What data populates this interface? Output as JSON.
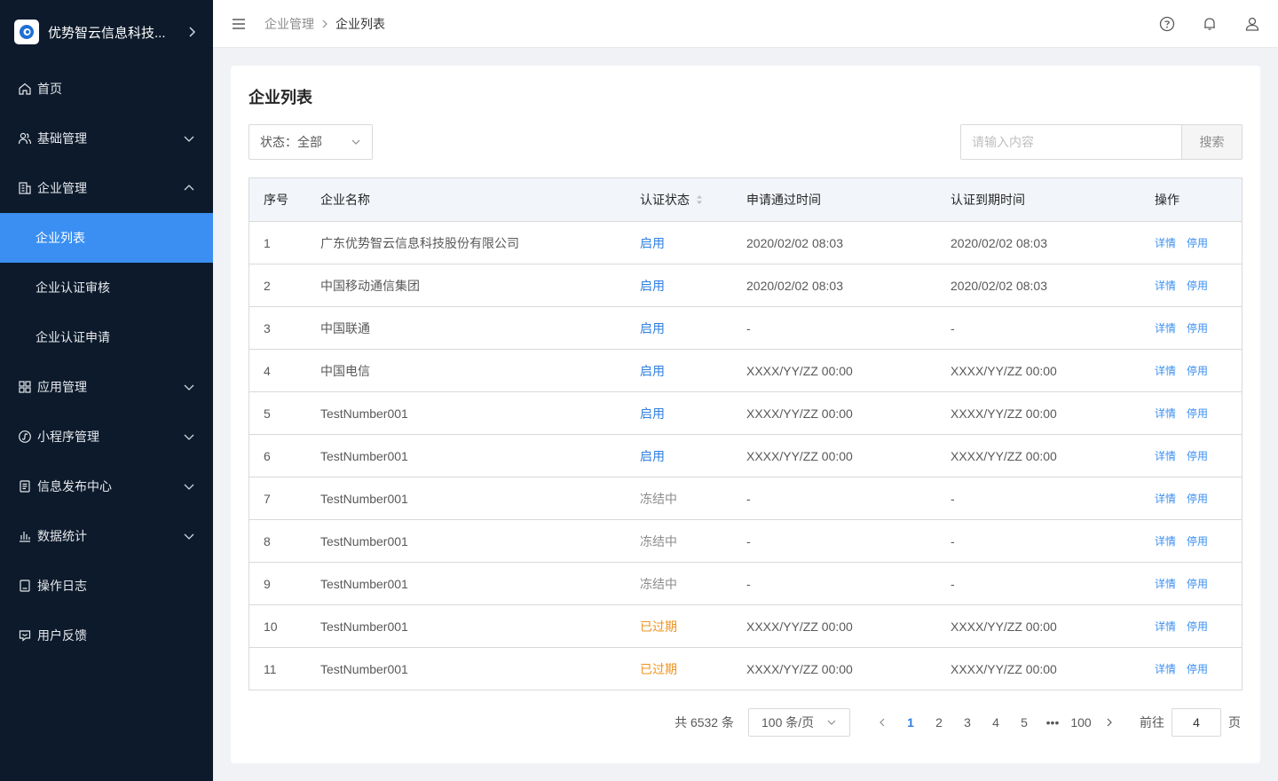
{
  "brand": {
    "name": "优势智云信息科技..."
  },
  "sidebar": {
    "items": [
      {
        "label": "首页",
        "icon": "home-icon",
        "expandable": false
      },
      {
        "label": "基础管理",
        "icon": "users-icon",
        "expandable": true,
        "expanded": false
      },
      {
        "label": "企业管理",
        "icon": "building-icon",
        "expandable": true,
        "expanded": true
      },
      {
        "label": "应用管理",
        "icon": "grid-icon",
        "expandable": true,
        "expanded": false
      },
      {
        "label": "小程序管理",
        "icon": "miniprogram-icon",
        "expandable": true,
        "expanded": false
      },
      {
        "label": "信息发布中心",
        "icon": "document-icon",
        "expandable": true,
        "expanded": false
      },
      {
        "label": "数据统计",
        "icon": "bar-chart-icon",
        "expandable": true,
        "expanded": false
      },
      {
        "label": "操作日志",
        "icon": "log-icon",
        "expandable": false
      },
      {
        "label": "用户反馈",
        "icon": "feedback-icon",
        "expandable": false
      }
    ],
    "sub_items": [
      "企业列表",
      "企业认证审核",
      "企业认证申请"
    ],
    "active_sub": "企业列表",
    "active_color": "#3b8ff2",
    "background": "#0c1a2b"
  },
  "header": {
    "breadcrumb_parent": "企业管理",
    "breadcrumb_current": "企业列表"
  },
  "page": {
    "title": "企业列表",
    "status_filter": "状态：全部",
    "search_placeholder": "请输入内容",
    "search_button": "搜索"
  },
  "table": {
    "columns": [
      "序号",
      "企业名称",
      "认证状态",
      "申请通过时间",
      "认证到期时间",
      "操作"
    ],
    "rows": [
      {
        "idx": "1",
        "name": "广东优势智云信息科技股份有限公司",
        "status": "启用",
        "status_type": "blue",
        "apply": "2020/02/02 08:03",
        "expire": "2020/02/02 08:03"
      },
      {
        "idx": "2",
        "name": "中国移动通信集团",
        "status": "启用",
        "status_type": "blue",
        "apply": "2020/02/02 08:03",
        "expire": "2020/02/02 08:03"
      },
      {
        "idx": "3",
        "name": "中国联通",
        "status": "启用",
        "status_type": "blue",
        "apply": "-",
        "expire": "-"
      },
      {
        "idx": "4",
        "name": "中国电信",
        "status": "启用",
        "status_type": "blue",
        "apply": "XXXX/YY/ZZ 00:00",
        "expire": "XXXX/YY/ZZ 00:00"
      },
      {
        "idx": "5",
        "name": "TestNumber001",
        "status": "启用",
        "status_type": "blue",
        "apply": "XXXX/YY/ZZ 00:00",
        "expire": "XXXX/YY/ZZ 00:00"
      },
      {
        "idx": "6",
        "name": "TestNumber001",
        "status": "启用",
        "status_type": "blue",
        "apply": "XXXX/YY/ZZ 00:00",
        "expire": "XXXX/YY/ZZ 00:00"
      },
      {
        "idx": "7",
        "name": "TestNumber001",
        "status": "冻结中",
        "status_type": "gray",
        "apply": "-",
        "expire": "-"
      },
      {
        "idx": "8",
        "name": "TestNumber001",
        "status": "冻结中",
        "status_type": "gray",
        "apply": "-",
        "expire": "-"
      },
      {
        "idx": "9",
        "name": "TestNumber001",
        "status": "冻结中",
        "status_type": "gray",
        "apply": "-",
        "expire": "-"
      },
      {
        "idx": "10",
        "name": "TestNumber001",
        "status": "已过期",
        "status_type": "orange",
        "apply": "XXXX/YY/ZZ 00:00",
        "expire": "XXXX/YY/ZZ 00:00"
      },
      {
        "idx": "11",
        "name": "TestNumber001",
        "status": "已过期",
        "status_type": "orange",
        "apply": "XXXX/YY/ZZ 00:00",
        "expire": "XXXX/YY/ZZ 00:00"
      }
    ],
    "op_detail": "详情",
    "op_disable": "停用",
    "status_colors": {
      "blue": "#2f7fe0",
      "gray": "#8c8c8c",
      "orange": "#f0931c"
    }
  },
  "pagination": {
    "total": "共 6532 条",
    "page_size": "100 条/页",
    "pages": [
      "1",
      "2",
      "3",
      "4",
      "5",
      "•••",
      "100"
    ],
    "current": "1",
    "goto_label": "前往",
    "goto_value": "4",
    "page_suffix": "页"
  }
}
